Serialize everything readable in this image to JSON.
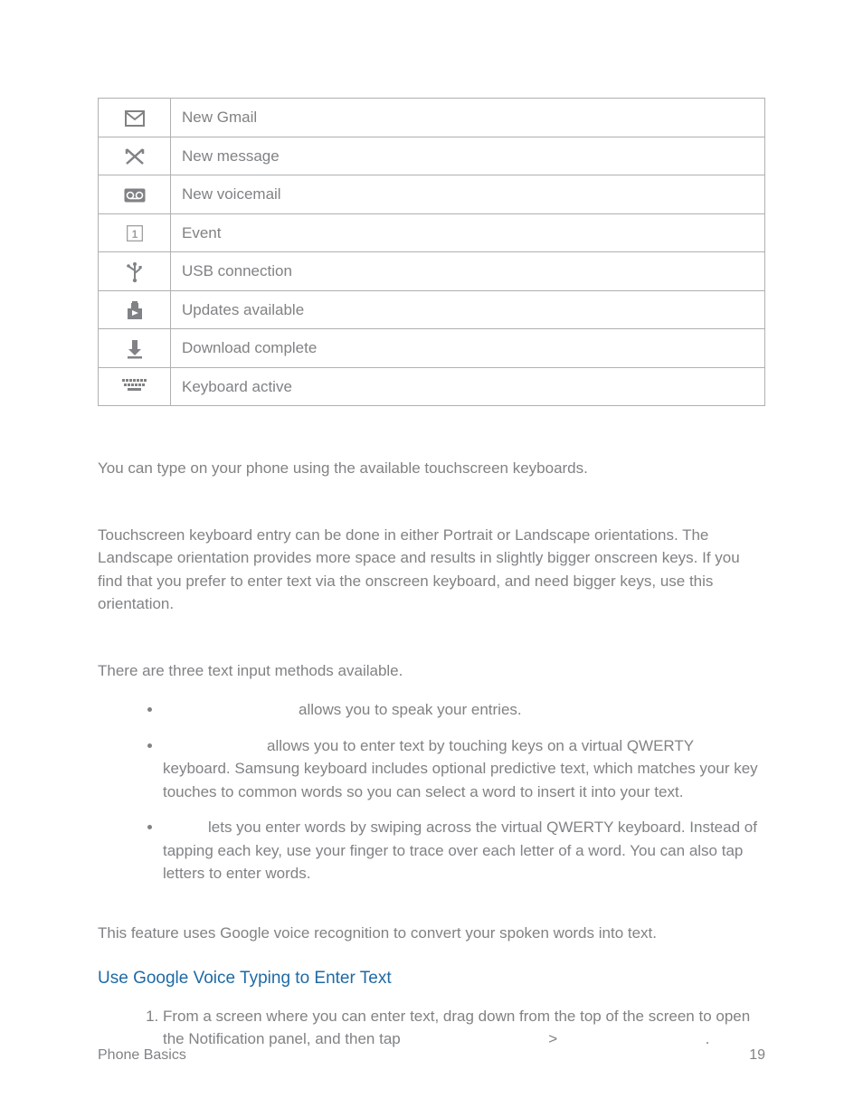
{
  "table": {
    "rows": [
      {
        "label": "New Gmail"
      },
      {
        "label": "New message"
      },
      {
        "label": "New voicemail"
      },
      {
        "label": "Event"
      },
      {
        "label": "USB connection"
      },
      {
        "label": "Updates available"
      },
      {
        "label": "Download complete"
      },
      {
        "label": "Keyboard active"
      }
    ]
  },
  "body": {
    "p1": "You can type on your phone using the available touchscreen keyboards.",
    "p2": "Touchscreen keyboard entry can be done in either Portrait or Landscape orientations. The Landscape orientation provides more space and results in slightly bigger onscreen keys. If you find that you prefer to enter text via the onscreen keyboard, and need bigger keys, use this orientation.",
    "p3": "There are three text input methods available.",
    "bullets": [
      "allows you to speak your entries.",
      "allows you to enter text by touching keys on a virtual QWERTY keyboard. Samsung keyboard includes optional predictive text, which matches your key touches to common words so you can select a word to insert it into your text.",
      "lets you enter words by swiping across the virtual QWERTY keyboard. Instead of tapping each key, use your finger to trace over each letter of a word. You can also tap letters to enter words."
    ],
    "p4": "This feature uses Google voice recognition to convert your spoken words into text.",
    "subhead": "Use Google Voice Typing to Enter Text",
    "step1a": "From a screen where you can enter text, drag down from the top of the screen to open the Notification panel, and then tap ",
    "gt": ">",
    "period": " ."
  },
  "footer": {
    "left": "Phone Basics",
    "right": "19"
  }
}
